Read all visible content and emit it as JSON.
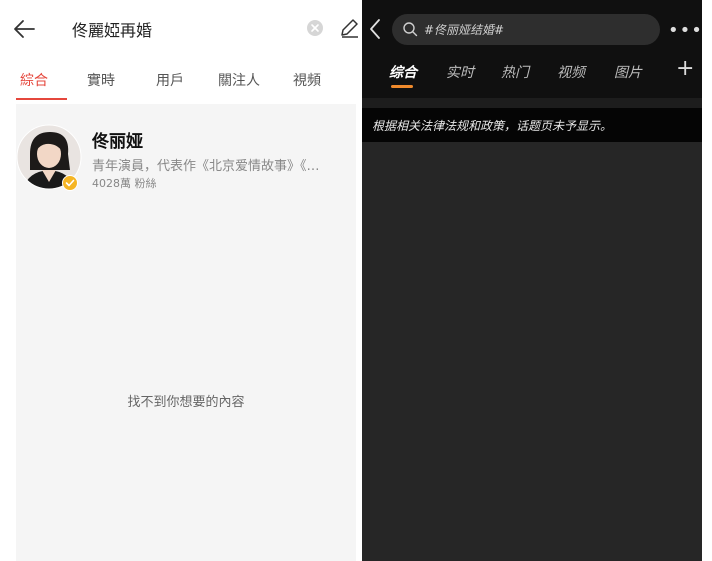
{
  "left_screen": {
    "search": {
      "query": "佟麗婭再婚"
    },
    "tabs": [
      {
        "label": "綜合",
        "active": true
      },
      {
        "label": "實時",
        "active": false
      },
      {
        "label": "用戶",
        "active": false
      },
      {
        "label": "關注人",
        "active": false
      },
      {
        "label": "視頻",
        "active": false
      }
    ],
    "user_card": {
      "name": "佟丽娅",
      "description": "青年演員，代表作《北京爱情故事》《…",
      "fans": "4028萬 粉絲"
    },
    "empty_message": "找不到你想要的內容",
    "colors": {
      "accent": "#e5473c",
      "body_bg": "#f5f5f5",
      "verified": "#f5b524"
    }
  },
  "right_screen": {
    "search": {
      "query": "#佟丽娅结婚#"
    },
    "tabs": [
      {
        "label": "综合",
        "active": true
      },
      {
        "label": "实时",
        "active": false
      },
      {
        "label": "热门",
        "active": false
      },
      {
        "label": "视频",
        "active": false
      },
      {
        "label": "图片",
        "active": false
      }
    ],
    "notice": "根据相关法律法规和政策，话题页未予显示。",
    "colors": {
      "accent": "#f08a2c",
      "background": "#262626"
    }
  }
}
